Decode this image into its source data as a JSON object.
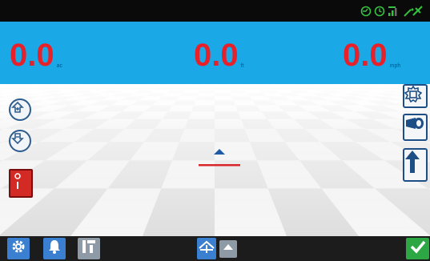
{
  "readouts": [
    {
      "value": "0.0",
      "unit": "ac"
    },
    {
      "value": "0.0",
      "unit": "ft"
    },
    {
      "value": "0.0",
      "unit": "mph"
    }
  ],
  "status_icons": [
    "gps-status-icon",
    "timer-icon",
    "signal-strength-icon",
    "satellite-icon"
  ],
  "colors": {
    "readout_bar": "#1aa8e6",
    "readout_value": "#e8202a",
    "status_icons": "#35c23f",
    "button_blue": "#3b7fd0",
    "confirm_green": "#2da644",
    "switch_red": "#d42a25"
  },
  "toolbar": {
    "left_buttons": [
      "gear-icon",
      "bell-icon",
      "layout-icon"
    ],
    "center_buttons": [
      "implement-view-icon",
      "collapse-icon"
    ],
    "right_button": "checkmark-icon"
  },
  "side_controls": {
    "left": [
      "zoom-in-icon",
      "zoom-out-icon",
      "master-switch-icon"
    ],
    "right": [
      "display-settings-icon",
      "camera-view-icon",
      "north-arrow-icon"
    ]
  }
}
